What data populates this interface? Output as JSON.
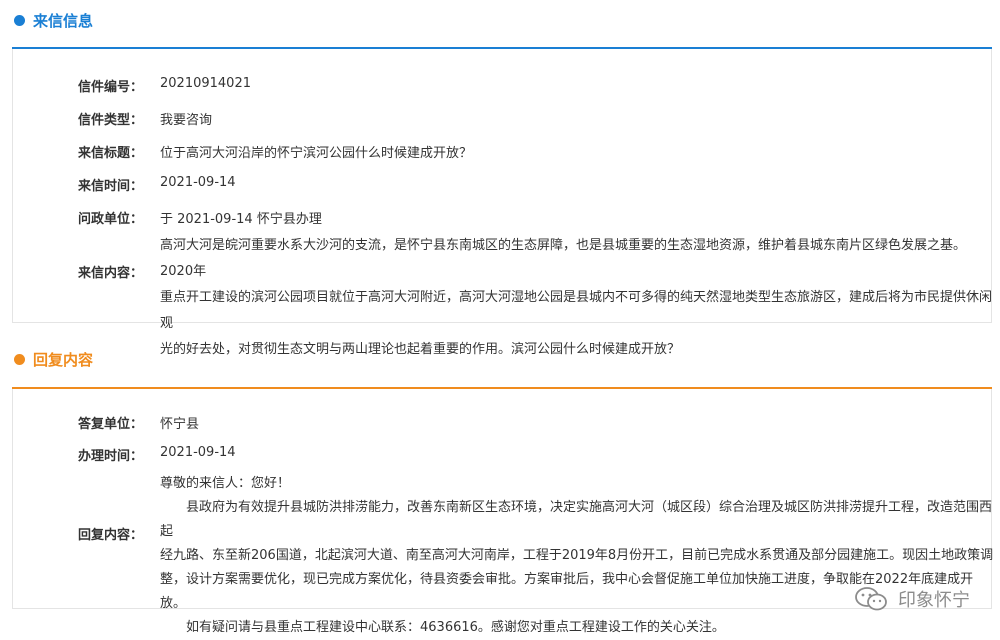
{
  "colors": {
    "blue": "#1a7fd4",
    "orange": "#f08c1e"
  },
  "letter_section": {
    "title": "来信信息",
    "fields": {
      "number_label": "信件编号：",
      "number_value": "20210914021",
      "type_label": "信件类型：",
      "type_value": "我要咨询",
      "subject_label": "来信标题：",
      "subject_value": "位于高河大河沿岸的怀宁滨河公园什么时候建成开放？",
      "time_label": "来信时间：",
      "time_value": "2021-09-14",
      "unit_label": "问政单位：",
      "unit_value": "于 2021-09-14  怀宁县办理",
      "content_label": "来信内容：",
      "content_lines": [
        "高河大河是皖河重要水系大沙河的支流，是怀宁县东南城区的生态屏障，也是县城重要的生态湿地资源，维护着县城东南片区绿色发展之基。2020年",
        "重点开工建设的滨河公园项目就位于高河大河附近，高河大河湿地公园是县城内不可多得的纯天然湿地类型生态旅游区，建成后将为市民提供休闲观",
        "光的好去处，对贯彻生态文明与两山理论也起着重要的作用。滨河公园什么时候建成开放？"
      ]
    }
  },
  "reply_section": {
    "title": "回复内容",
    "fields": {
      "unit_label": "答复单位：",
      "unit_value": "怀宁县",
      "time_label": "办理时间：",
      "time_value": "2021-09-14",
      "content_label": "回复内容：",
      "greeting": "尊敬的来信人：您好！",
      "body_lines": [
        "县政府为有效提升县城防洪排涝能力，改善东南新区生态环境，决定实施高河大河（城区段）综合治理及城区防洪排涝提升工程，改造范围西起",
        "经九路、东至新206国道，北起滨河大道、南至高河大河南岸，工程于2019年8月份开工，目前已完成水系贯通及部分园建施工。现因土地政策调",
        "整，设计方案需要优化，现已完成方案优化，待县资委会审批。方案审批后，我中心会督促施工单位加快施工进度，争取能在2022年底建成开放。"
      ],
      "closing": "如有疑问请与县重点工程建设中心联系：4636616。感谢您对重点工程建设工作的关心关注。"
    }
  },
  "watermark": {
    "text": "印象怀宁",
    "icon": "wechat-icon"
  }
}
